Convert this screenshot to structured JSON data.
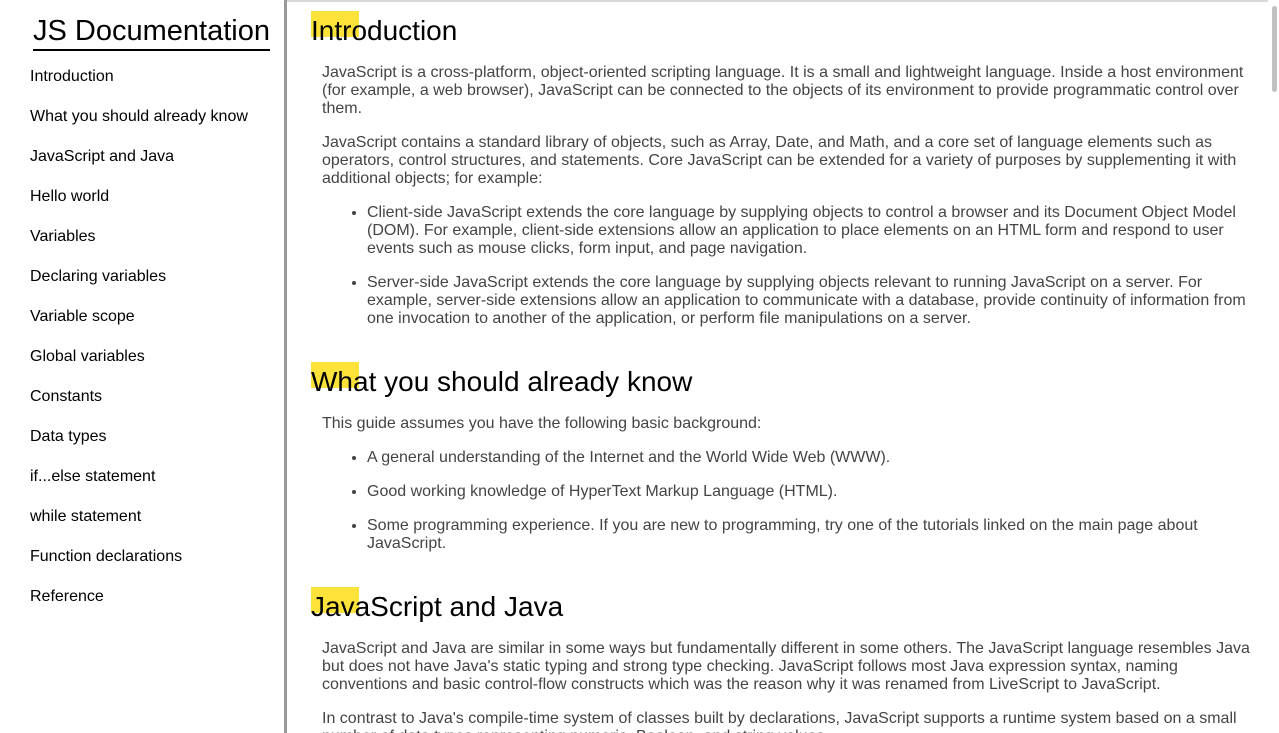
{
  "nav": {
    "header": "JS Documentation",
    "items": [
      {
        "label": "Introduction"
      },
      {
        "label": "What you should already know"
      },
      {
        "label": "JavaScript and Java"
      },
      {
        "label": "Hello world"
      },
      {
        "label": "Variables"
      },
      {
        "label": "Declaring variables"
      },
      {
        "label": "Variable scope"
      },
      {
        "label": "Global variables"
      },
      {
        "label": "Constants"
      },
      {
        "label": "Data types"
      },
      {
        "label": "if...else statement"
      },
      {
        "label": "while statement"
      },
      {
        "label": "Function declarations"
      },
      {
        "label": "Reference"
      }
    ]
  },
  "sections": [
    {
      "title": "Introduction",
      "paragraphs": [
        "JavaScript is a cross-platform, object-oriented scripting language. It is a small and lightweight language. Inside a host environment (for example, a web browser), JavaScript can be connected to the objects of its environment to provide programmatic control over them.",
        "JavaScript contains a standard library of objects, such as Array, Date, and Math, and a core set of language elements such as operators, control structures, and statements. Core JavaScript can be extended for a variety of purposes by supplementing it with additional objects; for example:"
      ],
      "list": [
        "Client-side JavaScript extends the core language by supplying objects to control a browser and its Document Object Model (DOM). For example, client-side extensions allow an application to place elements on an HTML form and respond to user events such as mouse clicks, form input, and page navigation.",
        "Server-side JavaScript extends the core language by supplying objects relevant to running JavaScript on a server. For example, server-side extensions allow an application to communicate with a database, provide continuity of information from one invocation to another of the application, or perform file manipulations on a server."
      ]
    },
    {
      "title": "What you should already know",
      "paragraphs": [
        "This guide assumes you have the following basic background:"
      ],
      "list": [
        "A general understanding of the Internet and the World Wide Web (WWW).",
        "Good working knowledge of HyperText Markup Language (HTML).",
        "Some programming experience. If you are new to programming, try one of the tutorials linked on the main page about JavaScript."
      ]
    },
    {
      "title": "JavaScript and Java",
      "paragraphs": [
        "JavaScript and Java are similar in some ways but fundamentally different in some others. The JavaScript language resembles Java but does not have Java's static typing and strong type checking. JavaScript follows most Java expression syntax, naming conventions and basic control-flow constructs which was the reason why it was renamed from LiveScript to JavaScript.",
        "In contrast to Java's compile-time system of classes built by declarations, JavaScript supports a runtime system based on a small number of data types representing numeric, Boolean, and string values."
      ],
      "list": []
    }
  ],
  "colors": {
    "highlight": "#fde23a",
    "nav_border": "#9a9a9a",
    "body_text": "#444444"
  }
}
